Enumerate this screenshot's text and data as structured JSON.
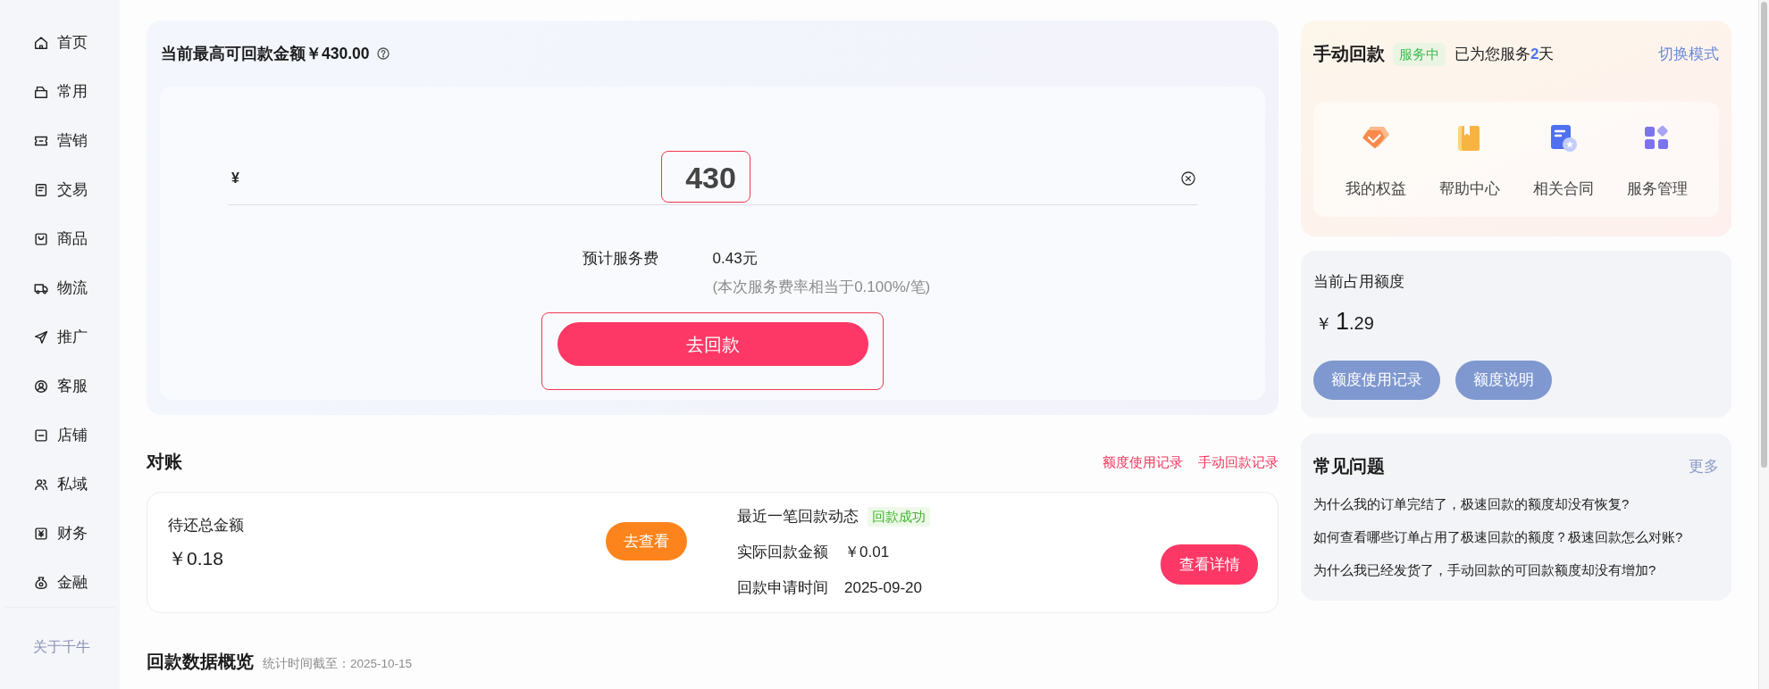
{
  "sidebar": {
    "items": [
      {
        "label": "首页",
        "selected": false
      },
      {
        "label": "常用",
        "selected": false
      },
      {
        "label": "营销",
        "selected": false
      },
      {
        "label": "交易",
        "selected": false
      },
      {
        "label": "商品",
        "selected": false
      },
      {
        "label": "物流",
        "selected": false
      },
      {
        "label": "推广",
        "selected": false
      },
      {
        "label": "客服",
        "selected": false
      },
      {
        "label": "店铺",
        "selected": false
      },
      {
        "label": "私域",
        "selected": false
      },
      {
        "label": "财务",
        "selected": false
      },
      {
        "label": "金融",
        "selected": false
      }
    ],
    "footer_link": "关于千牛"
  },
  "payback_panel": {
    "title": "当前最高可回款金额￥430.00",
    "amount_input": {
      "prefix": "¥",
      "value": "430",
      "highlighted": true
    },
    "fee_label": "预计服务费",
    "fee_value": "0.43元",
    "fee_note": "(本次服务费率相当于0.100%/笔)",
    "submit_button": {
      "label": "去回款",
      "highlighted": true
    }
  },
  "reconciliation": {
    "title": "对账",
    "links": [
      "额度使用记录",
      "手动回款记录"
    ],
    "outstanding": {
      "label": "待还总金额",
      "amount": "￥0.18",
      "button": "去查看"
    },
    "latest": {
      "title": "最近一笔回款动态",
      "status_tag": "回款成功",
      "rows": [
        {
          "label": "实际回款金额",
          "value": "￥0.01"
        },
        {
          "label": "回款申请时间",
          "value": "2025-09-20"
        }
      ],
      "button": "查看详情"
    }
  },
  "overview": {
    "title": "回款数据概览",
    "note": "统计时间截至：2025-10-15"
  },
  "manual_payback": {
    "title": "手动回款",
    "status_tag": "服务中",
    "service_text": "已为您服务**2**天",
    "switch_link": "切换模式",
    "shortcuts": [
      "我的权益",
      "帮助中心",
      "相关合同",
      "服务管理"
    ]
  },
  "quota": {
    "title": "当前占用额度",
    "amount_symbol": "￥",
    "amount_integer": "1",
    "amount_decimal": ".29",
    "buttons": [
      "额度使用记录",
      "额度说明"
    ]
  },
  "faq": {
    "title": "常见问题",
    "more_link": "更多",
    "questions": [
      "为什么我的订单完结了，极速回款的额度却没有恢复?",
      "如何查看哪些订单占用了极速回款的额度？极速回款怎么对账?",
      "为什么我已经发货了，手动回款的可回款额度却没有增加?"
    ]
  }
}
